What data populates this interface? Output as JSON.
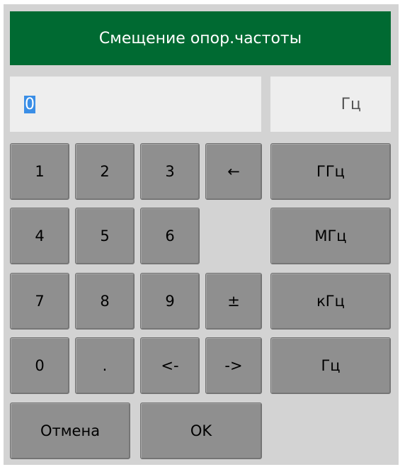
{
  "dialog": {
    "title": "Смещение опор.частоты",
    "value": "0",
    "unit": "Гц"
  },
  "keys": {
    "one": "1",
    "two": "2",
    "three": "3",
    "backspace": "←",
    "ghz": "ГГц",
    "four": "4",
    "five": "5",
    "six": "6",
    "mhz": "МГц",
    "seven": "7",
    "eight": "8",
    "nine": "9",
    "plus_minus": "±",
    "khz": "кГц",
    "zero": "0",
    "dot": ".",
    "left": "<-",
    "right": "->",
    "hz": "Гц",
    "cancel": "Отмена",
    "ok": "OK"
  }
}
